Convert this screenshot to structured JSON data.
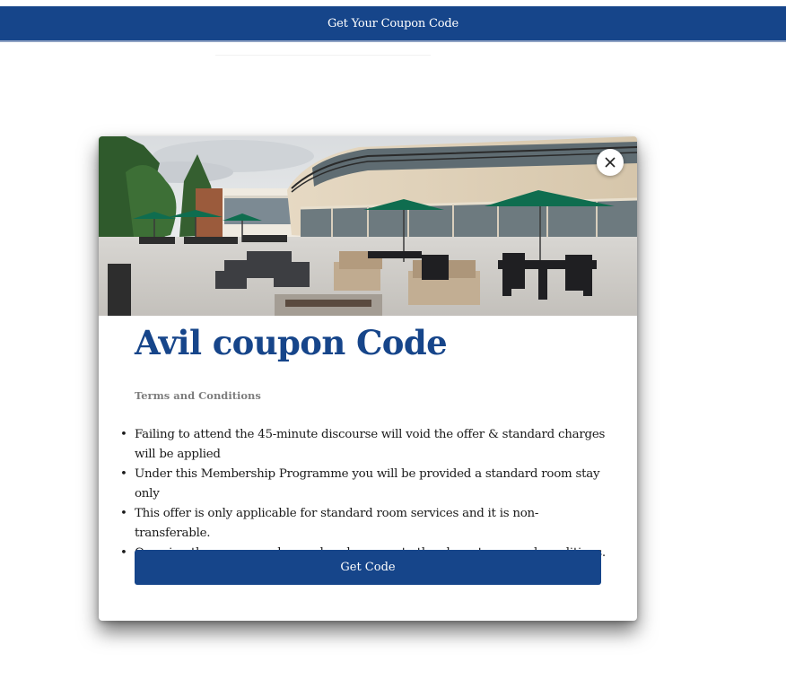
{
  "top_bar": {
    "label": "Get Your Coupon Code"
  },
  "modal": {
    "hero_image": "resort-patio-with-umbrellas",
    "close_icon": "close-icon",
    "title": "Avil coupon Code",
    "terms_heading": "Terms and Conditions",
    "terms": [
      "Failing to attend the 45-minute discourse will void the offer & standard charges will be applied",
      "Under this Membership Programme you will be provided a standard room stay only",
      "This offer is only applicable for standard room services and it is non-transferable.",
      "On using the coupon code, you hereby agree to the above terms and conditions."
    ],
    "button_label": "Get Code"
  },
  "colors": {
    "brand_blue": "#16458a",
    "terms_heading_gray": "#7e7e7e",
    "background": "#ffffff"
  }
}
